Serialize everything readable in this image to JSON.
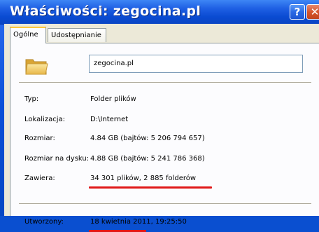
{
  "window": {
    "title": "Właściwości: zegocina.pl",
    "help_label": "?",
    "close_label": "✕"
  },
  "tabs": [
    {
      "label": "Ogólne",
      "active": true
    },
    {
      "label": "Udostępnianie",
      "active": false
    }
  ],
  "general": {
    "folder_icon": "folder-icon",
    "name_value": "zegocina.pl",
    "rows": [
      {
        "label": "Typ:",
        "value": "Folder plików"
      },
      {
        "label": "Lokalizacja:",
        "value": "D:\\Internet"
      },
      {
        "label": "Rozmiar:",
        "value": "4.84 GB (bajtów: 5 206 794 657)"
      },
      {
        "label": "Rozmiar na dysku:",
        "value": "4.88 GB (bajtów: 5 241 786 368)"
      },
      {
        "label": "Zawiera:",
        "value": "34 301 plików, 2 885 folderów"
      },
      {
        "label": "Utworzony:",
        "value": "18 kwietnia 2011, 19:25:50"
      }
    ]
  },
  "annotations": {
    "underline_color": "#e01818"
  }
}
